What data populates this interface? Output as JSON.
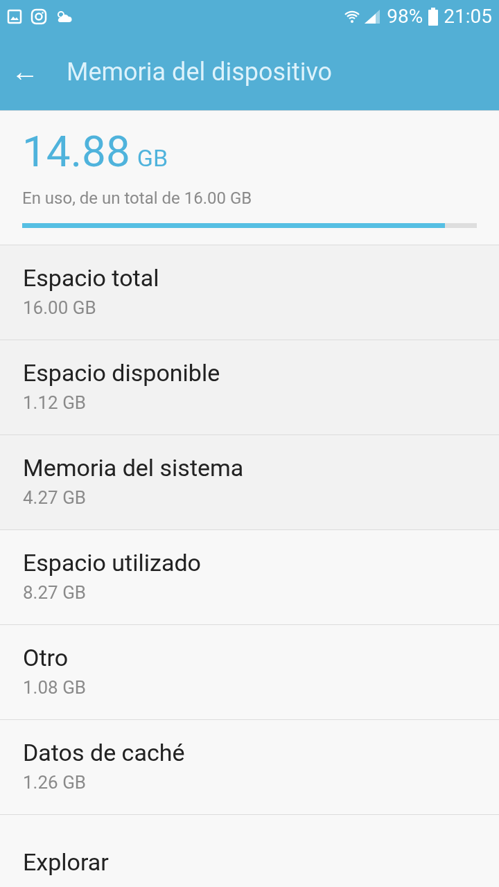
{
  "status_bar": {
    "battery": "98%",
    "time": "21:05"
  },
  "toolbar": {
    "back": "←",
    "title": "Memoria del dispositivo"
  },
  "summary": {
    "value": "14.88",
    "unit": "GB",
    "caption": "En uso, de un total de 16.00 GB",
    "level": 0.93
  },
  "items": [
    {
      "title": "Espacio total",
      "value": "16.00 GB",
      "kind": "info"
    },
    {
      "title": "Espacio disponible",
      "value": "1.12 GB",
      "kind": "info"
    },
    {
      "title": "Memoria del sistema",
      "value": "4.27 GB",
      "kind": "info"
    },
    {
      "title": "Espacio utilizado",
      "value": "8.27 GB",
      "kind": "link"
    },
    {
      "title": "Otro",
      "value": "1.08 GB",
      "kind": "link"
    },
    {
      "title": "Datos de caché",
      "value": "1.26 GB",
      "kind": "link"
    },
    {
      "title": "Explorar",
      "kind": "link"
    }
  ]
}
